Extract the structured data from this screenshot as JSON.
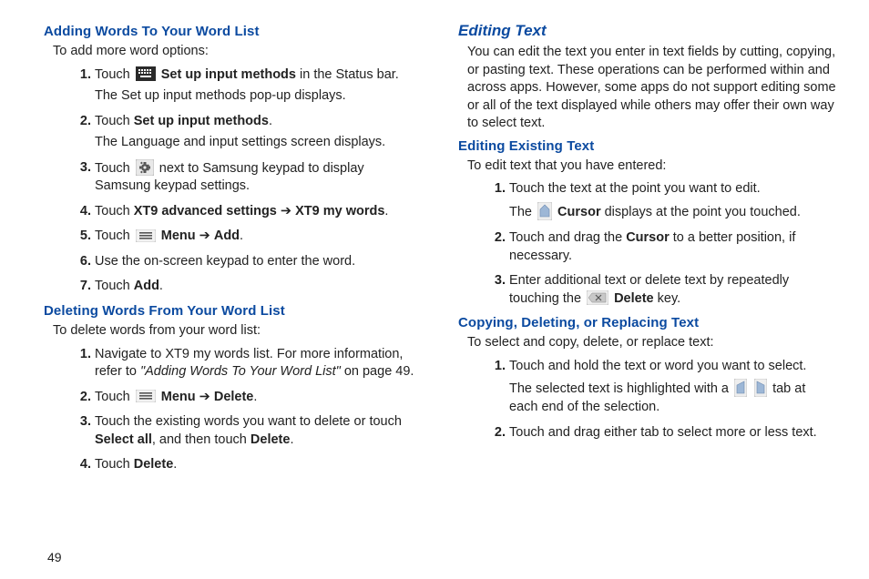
{
  "left": {
    "h1": "Adding Words To Your Word List",
    "intro1": "To add more word options:",
    "s1a": "Touch ",
    "s1b": "Set up input methods",
    "s1c": " in the Status bar.",
    "s1d": "The Set up input methods pop-up displays.",
    "s2a": "Touch ",
    "s2b": "Set up input methods",
    "s2c": ".",
    "s2d": "The Language and input settings screen displays.",
    "s3a": "Touch ",
    "s3b": " next to Samsung keypad to display Samsung keypad settings.",
    "s4a": "Touch ",
    "s4b": "XT9 advanced settings",
    "s4arrow": " ➔ ",
    "s4c": "XT9 my words",
    "s4d": ".",
    "s5a": "Touch ",
    "s5b": "Menu",
    "s5arrow": " ➔ ",
    "s5c": "Add",
    "s5d": ".",
    "s6": "Use the on-screen keypad to enter the word.",
    "s7a": "Touch ",
    "s7b": "Add",
    "s7c": ".",
    "h2": "Deleting Words From Your Word List",
    "intro2": "To delete words from your word list:",
    "d1a": "Navigate to XT9 my words list. For more information, refer to ",
    "d1b": "\"Adding Words To Your Word List\"",
    "d1c": " on page 49.",
    "d2a": "Touch ",
    "d2b": "Menu",
    "d2arrow": " ➔ ",
    "d2c": "Delete",
    "d2d": ".",
    "d3a": "Touch the existing words you want to delete or touch ",
    "d3b": "Select all",
    "d3c": ", and then touch ",
    "d3d": "Delete",
    "d3e": ".",
    "d4a": "Touch ",
    "d4b": "Delete",
    "d4c": "."
  },
  "right": {
    "h1": "Editing Text",
    "para": "You can edit the text you enter in text fields by cutting, copying, or pasting text. These operations can be performed within and across apps. However, some apps do not support editing some or all of the text displayed while others may offer their own way to select text.",
    "h2": "Editing Existing Text",
    "intro2": "To edit text that you have entered:",
    "e1a": "Touch the text at the point you want to edit.",
    "e1b": "The ",
    "e1c": "Cursor",
    "e1d": " displays at the point you touched.",
    "e2a": "Touch and drag the ",
    "e2b": "Cursor",
    "e2c": " to a better position, if necessary.",
    "e3a": "Enter additional text or delete text by repeatedly touching the ",
    "e3b": "Delete",
    "e3c": " key.",
    "h3": "Copying, Deleting, or Replacing Text",
    "intro3": "To select and copy, delete, or replace text:",
    "c1a": "Touch and hold the text or word you want to select.",
    "c1b": "The selected text is highlighted with a ",
    "c1c": " tab at each end of the selection.",
    "c2": "Touch and drag either tab to select more or less text."
  },
  "page_number": "49"
}
